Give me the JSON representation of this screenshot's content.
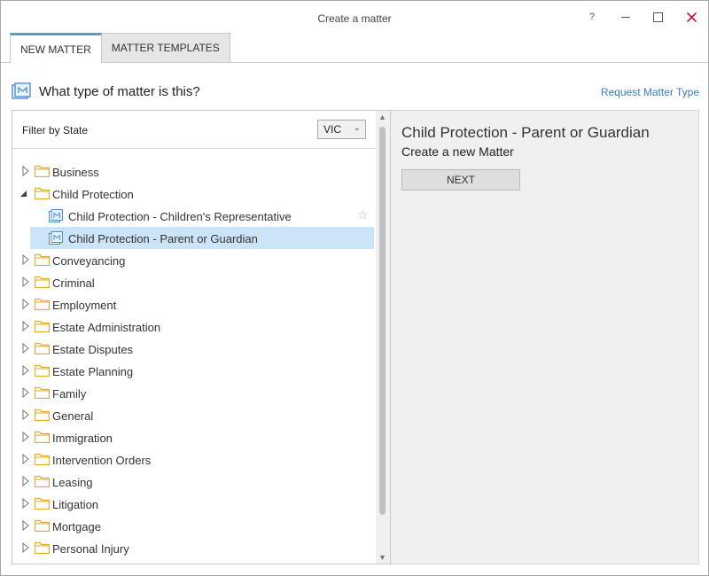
{
  "window": {
    "title": "Create a matter",
    "help": "?",
    "minimize": "—",
    "maximize": "☐",
    "close": "✕"
  },
  "tabs": [
    {
      "label": "NEW MATTER",
      "active": true
    },
    {
      "label": "MATTER TEMPLATES",
      "active": false
    }
  ],
  "heading": {
    "question": "What type of matter is this?",
    "request_link": "Request Matter Type"
  },
  "filter": {
    "label": "Filter by State",
    "selected": "VIC"
  },
  "tree": [
    {
      "label": "Business",
      "type": "folder",
      "expanded": false
    },
    {
      "label": "Child Protection",
      "type": "folder",
      "expanded": true
    },
    {
      "label": "Child Protection - Children's Representative",
      "type": "matter",
      "favorite_icon": "star-outline"
    },
    {
      "label": "Child Protection - Parent or Guardian",
      "type": "matter",
      "selected": true
    },
    {
      "label": "Conveyancing",
      "type": "folder",
      "expanded": false
    },
    {
      "label": "Criminal",
      "type": "folder",
      "expanded": false
    },
    {
      "label": "Employment",
      "type": "folder",
      "expanded": false
    },
    {
      "label": "Estate Administration",
      "type": "folder",
      "expanded": false
    },
    {
      "label": "Estate Disputes",
      "type": "folder",
      "expanded": false
    },
    {
      "label": "Estate Planning",
      "type": "folder",
      "expanded": false
    },
    {
      "label": "Family",
      "type": "folder",
      "expanded": false
    },
    {
      "label": "General",
      "type": "folder",
      "expanded": false
    },
    {
      "label": "Immigration",
      "type": "folder",
      "expanded": false
    },
    {
      "label": "Intervention Orders",
      "type": "folder",
      "expanded": false
    },
    {
      "label": "Leasing",
      "type": "folder",
      "expanded": false
    },
    {
      "label": "Litigation",
      "type": "folder",
      "expanded": false
    },
    {
      "label": "Mortgage",
      "type": "folder",
      "expanded": false
    },
    {
      "label": "Personal Injury",
      "type": "folder",
      "expanded": false
    }
  ],
  "detail": {
    "title": "Child Protection - Parent or Guardian",
    "subtitle": "Create a new Matter",
    "next_label": "NEXT"
  },
  "colors": {
    "accent": "#4aa3df",
    "link": "#3a7cc4",
    "selection": "#cce4f7",
    "folder": "#e8a92a",
    "close": "#c8102e"
  }
}
